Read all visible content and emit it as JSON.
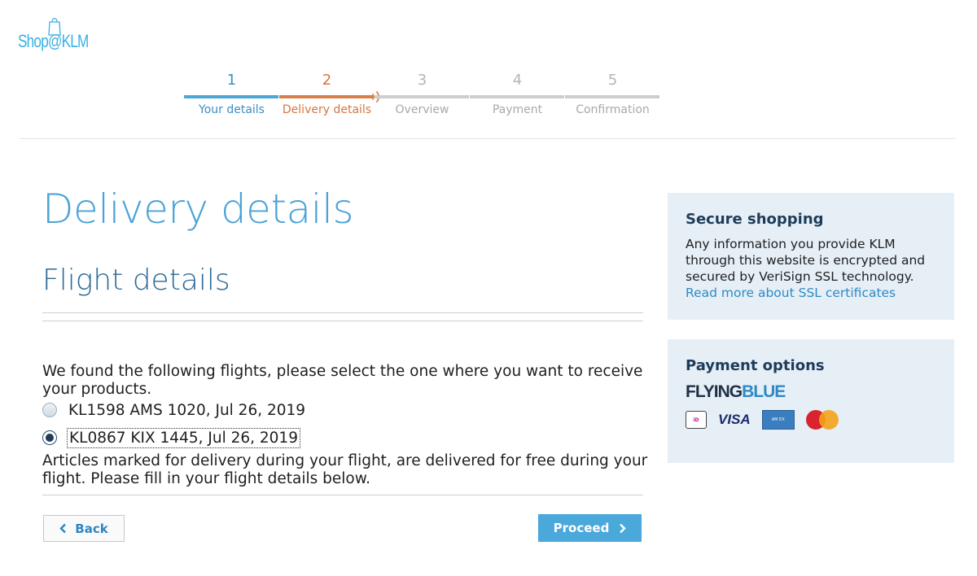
{
  "logo": {
    "text": "Shop@KLM"
  },
  "stepper": {
    "steps": [
      {
        "number": "1",
        "label": "Your details"
      },
      {
        "number": "2",
        "label": "Delivery details"
      },
      {
        "number": "3",
        "label": "Overview"
      },
      {
        "number": "4",
        "label": "Payment"
      },
      {
        "number": "5",
        "label": "Confirmation"
      }
    ],
    "current_step": 2
  },
  "main": {
    "title": "Delivery details",
    "section_title": "Flight details",
    "intro": "We found the following flights, please select the one where you want to receive your products.",
    "flights": [
      {
        "label": "KL1598 AMS 1020, Jul 26, 2019",
        "selected": false
      },
      {
        "label": "KL0867 KIX 1445, Jul 26, 2019",
        "selected": true
      }
    ],
    "note": "Articles marked for delivery during your flight, are delivered for free during your flight. Please fill in your flight details below.",
    "back_label": "Back",
    "proceed_label": "Proceed"
  },
  "sidebar": {
    "secure": {
      "title": "Secure shopping",
      "text": "Any information you provide KLM through this website is encrypted and secured by VeriSign SSL technology.",
      "link": "Read more about SSL certificates"
    },
    "payment": {
      "title": "Payment options",
      "brand_flying": "FLYING",
      "brand_blue": "BLUE",
      "visa": "VISA"
    }
  },
  "colors": {
    "accent": "#4aa3d7",
    "current_step": "#d97e48",
    "panel_bg": "#e6eff6"
  }
}
